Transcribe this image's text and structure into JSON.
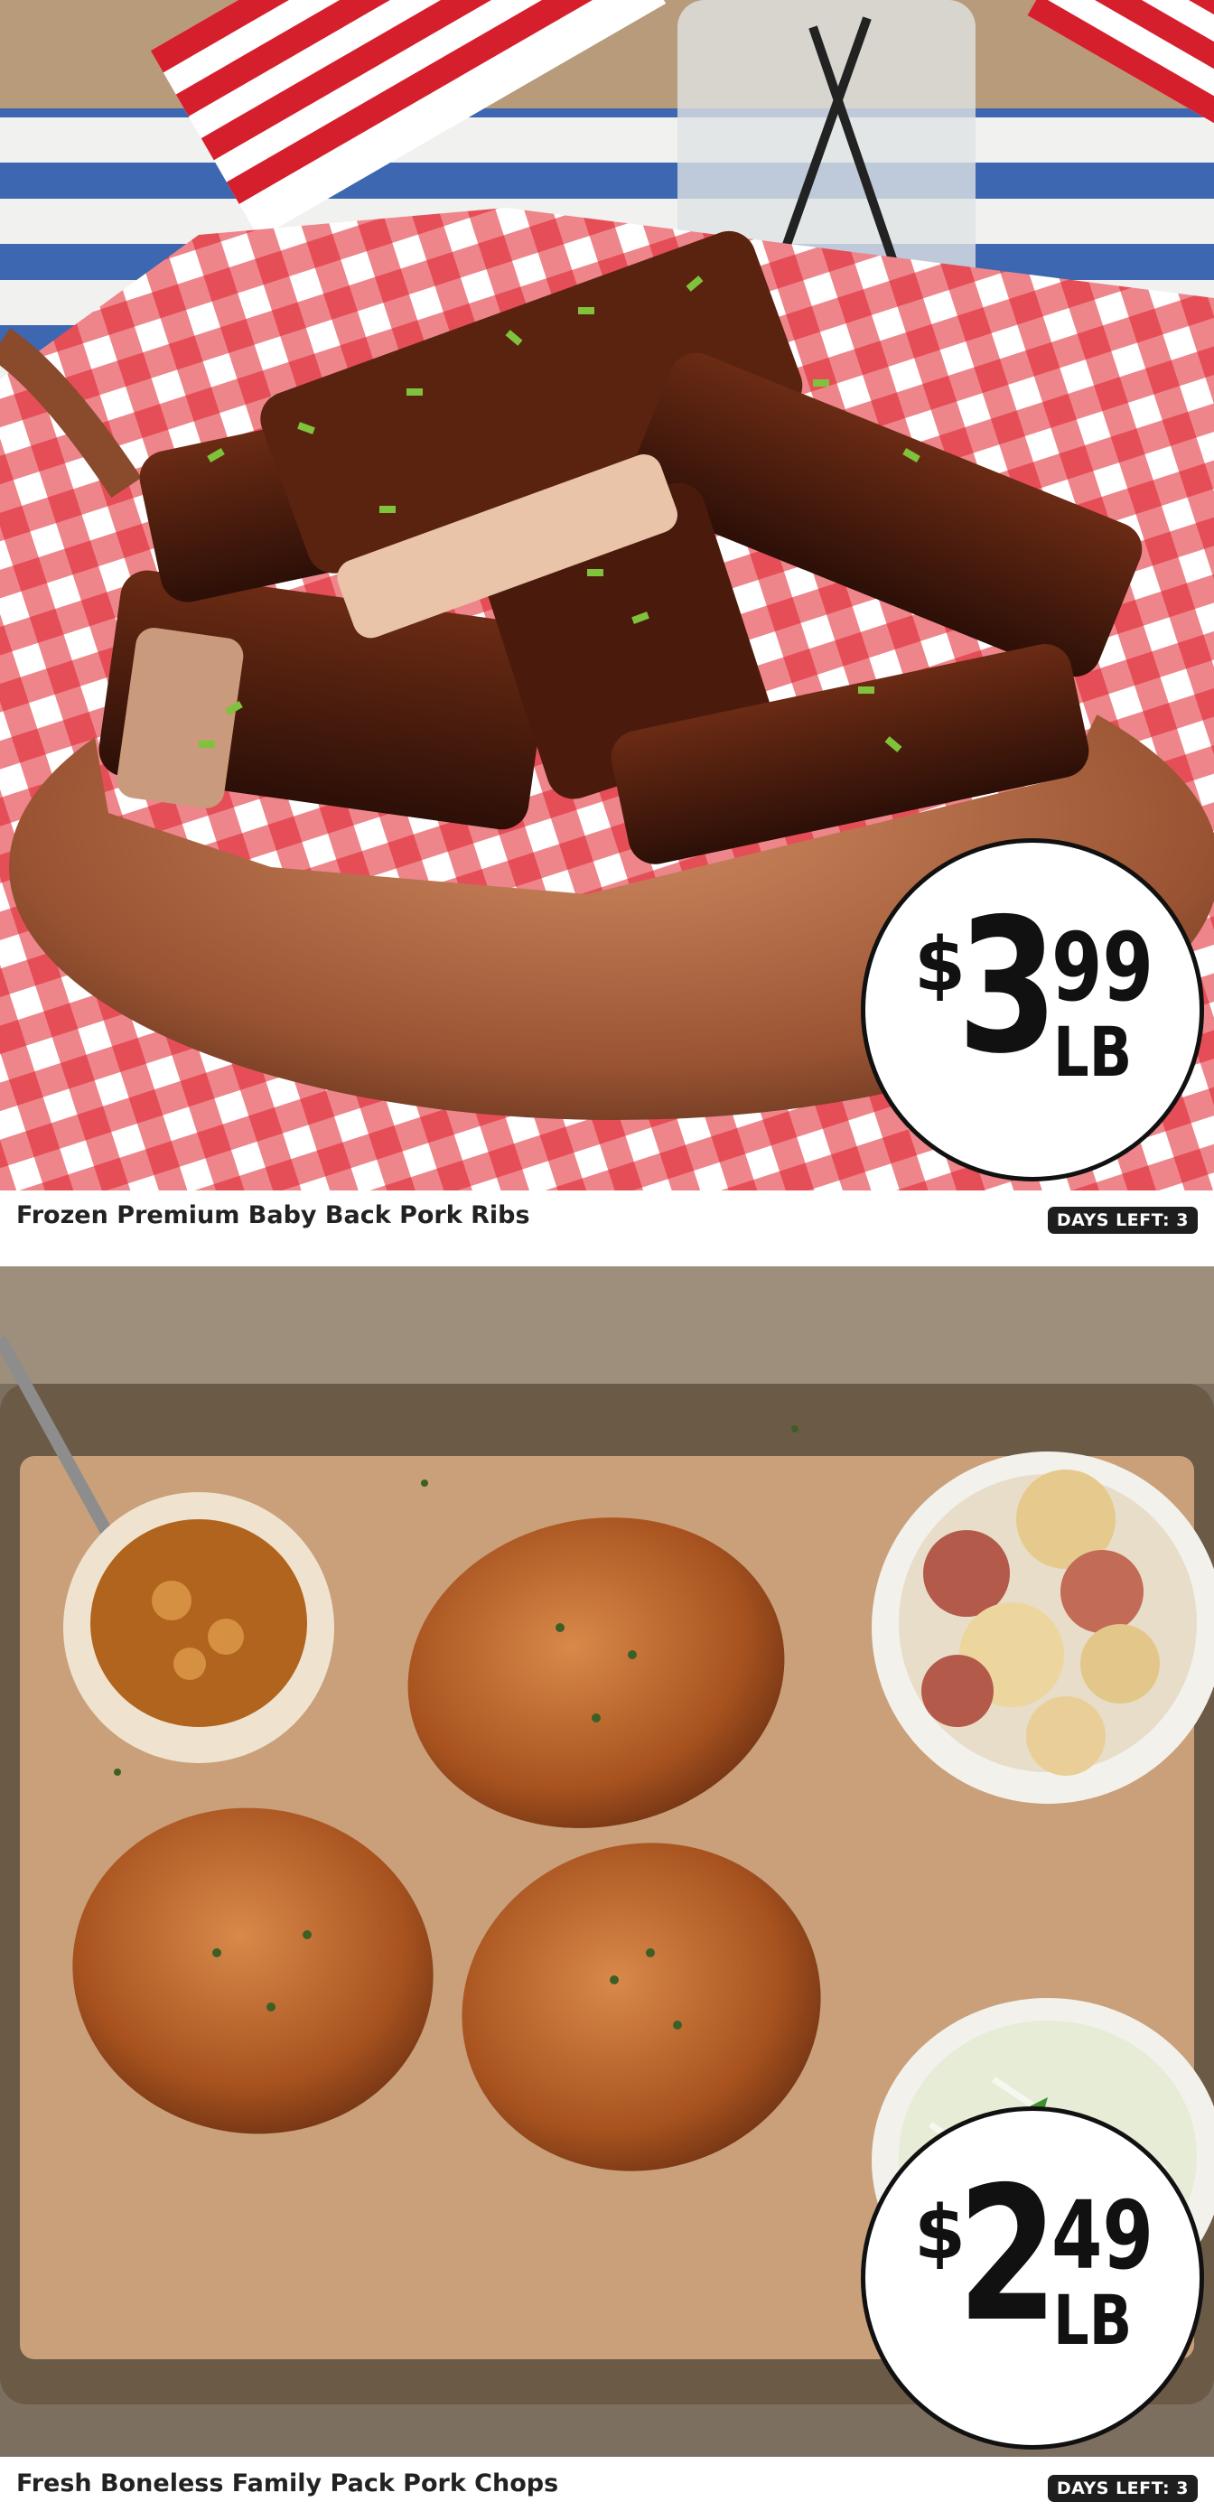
{
  "deals": [
    {
      "title": "Frozen Premium Baby Back Pork Ribs",
      "price": {
        "currency": "$",
        "whole": "3",
        "cents": "99",
        "unit": "LB"
      },
      "days_left": "DAYS LEFT: 3",
      "image": "bbq-pork-ribs-in-copper-pan-icon"
    },
    {
      "title": "Fresh Boneless Family Pack Pork Chops",
      "price": {
        "currency": "$",
        "whole": "2",
        "cents": "49",
        "unit": "LB"
      },
      "days_left": "DAYS LEFT: 3",
      "image": "glazed-pork-chops-on-tray-icon"
    }
  ],
  "colors": {
    "badge_bg": "#1e1e1e",
    "price_circle_bg": "#ffffff",
    "gingham_red": "#e0212b",
    "copper": "#b06a45"
  }
}
